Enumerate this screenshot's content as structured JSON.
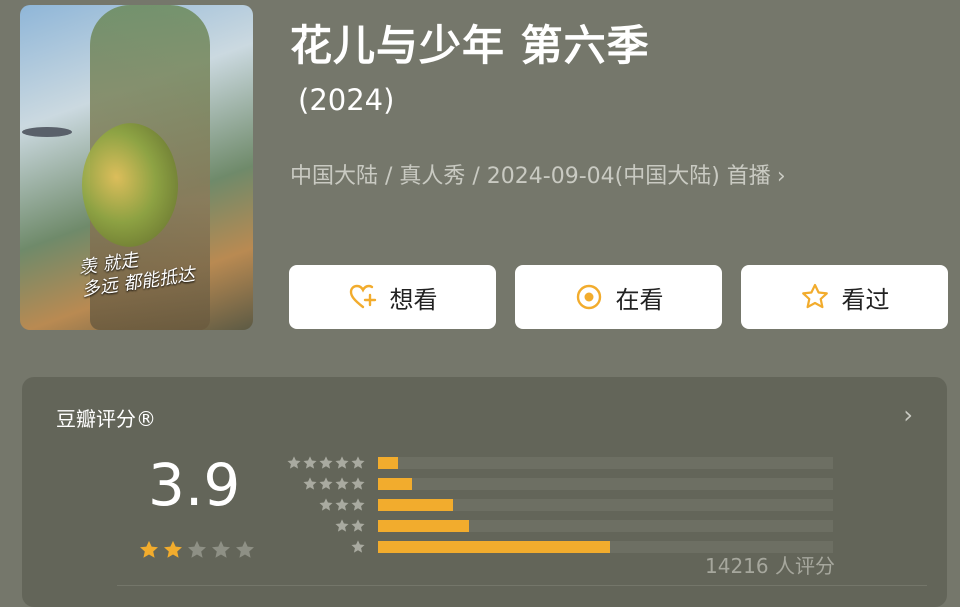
{
  "poster": {
    "tagline": "羡 就走\n多远 都能抵达"
  },
  "header": {
    "title": "花儿与少年 第六季",
    "year": "(2024)",
    "meta": "中国大陆 / 真人秀 / 2024-09-04(中国大陆) 首播"
  },
  "actions": [
    {
      "label": "想看",
      "icon": "heart-plus-icon"
    },
    {
      "label": "在看",
      "icon": "target-icon"
    },
    {
      "label": "看过",
      "icon": "star-outline-icon"
    }
  ],
  "rating": {
    "title": "豆瓣评分®",
    "score": "3.9",
    "stars_value": 2,
    "stars_total": 5,
    "distribution": [
      {
        "stars": 5,
        "fraction": 0.045
      },
      {
        "stars": 4,
        "fraction": 0.075
      },
      {
        "stars": 3,
        "fraction": 0.165
      },
      {
        "stars": 2,
        "fraction": 0.2
      },
      {
        "stars": 1,
        "fraction": 0.51
      }
    ],
    "count": "14216 人评分"
  },
  "colors": {
    "background": "#75776b",
    "card": "#636559",
    "accent": "#f2ac2d"
  }
}
